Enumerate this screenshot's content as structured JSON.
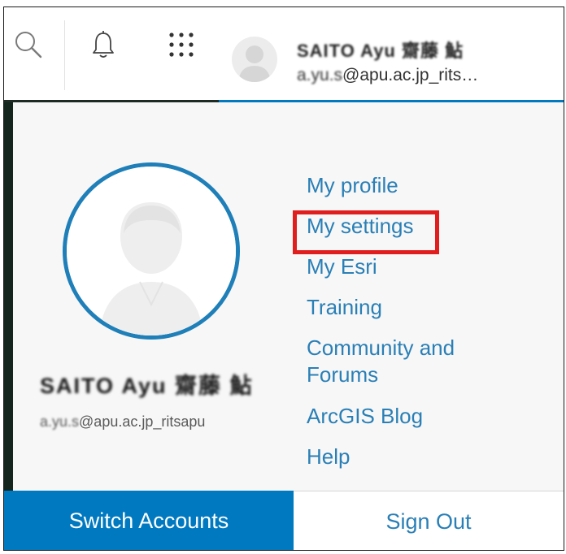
{
  "header": {
    "search_icon": "search-icon",
    "notifications_icon": "bell-icon",
    "apps_icon": "app-launcher-grid-icon",
    "user": {
      "name": "SAITO Ayu 齋藤 鮎",
      "email_prefix": "a.yu.s",
      "email_suffix": "@apu.ac.jp_rits…"
    }
  },
  "profile": {
    "name": "SAITO Ayu 齋藤 鮎",
    "email_prefix": "a.yu.s",
    "email_suffix": "@apu.ac.jp_ritsapu"
  },
  "menu": {
    "items": [
      {
        "label": "My profile"
      },
      {
        "label": "My settings"
      },
      {
        "label": "My Esri"
      },
      {
        "label": "Training"
      },
      {
        "label": "Community and"
      },
      {
        "label": "Forums"
      },
      {
        "label": "ArcGIS Blog"
      },
      {
        "label": "Help"
      }
    ],
    "highlighted": "My settings",
    "highlight_color": "#e01e1e",
    "link_color": "#2a7fb6"
  },
  "footer": {
    "switch_accounts_label": "Switch Accounts",
    "sign_out_label": "Sign Out",
    "primary_color": "#0079c1"
  }
}
